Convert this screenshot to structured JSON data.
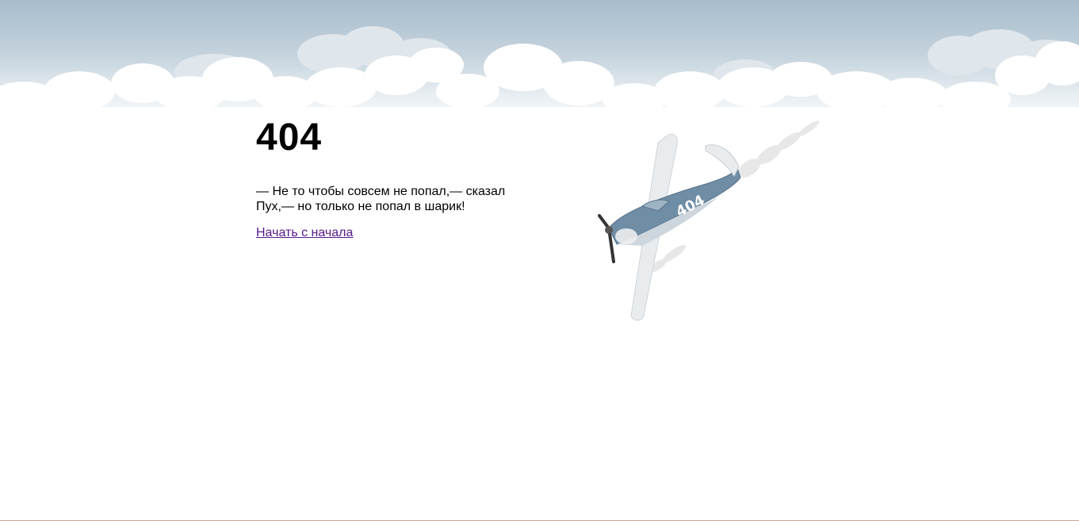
{
  "error": {
    "code": "404"
  },
  "quote": {
    "line1": "— Не то чтобы совсем не попал,— сказал",
    "line2": "Пух,— но только не попал в шарик!"
  },
  "link": {
    "label": "Начать с начала"
  },
  "plane": {
    "tail_number": "404",
    "icon": "crashing-airplane-icon"
  },
  "colors": {
    "sky_top": "#a9bfcf",
    "cloud": "#ffffff",
    "link": "#551a8b",
    "plane_body": "#6f8da5",
    "footer_line": "#c9a596"
  }
}
